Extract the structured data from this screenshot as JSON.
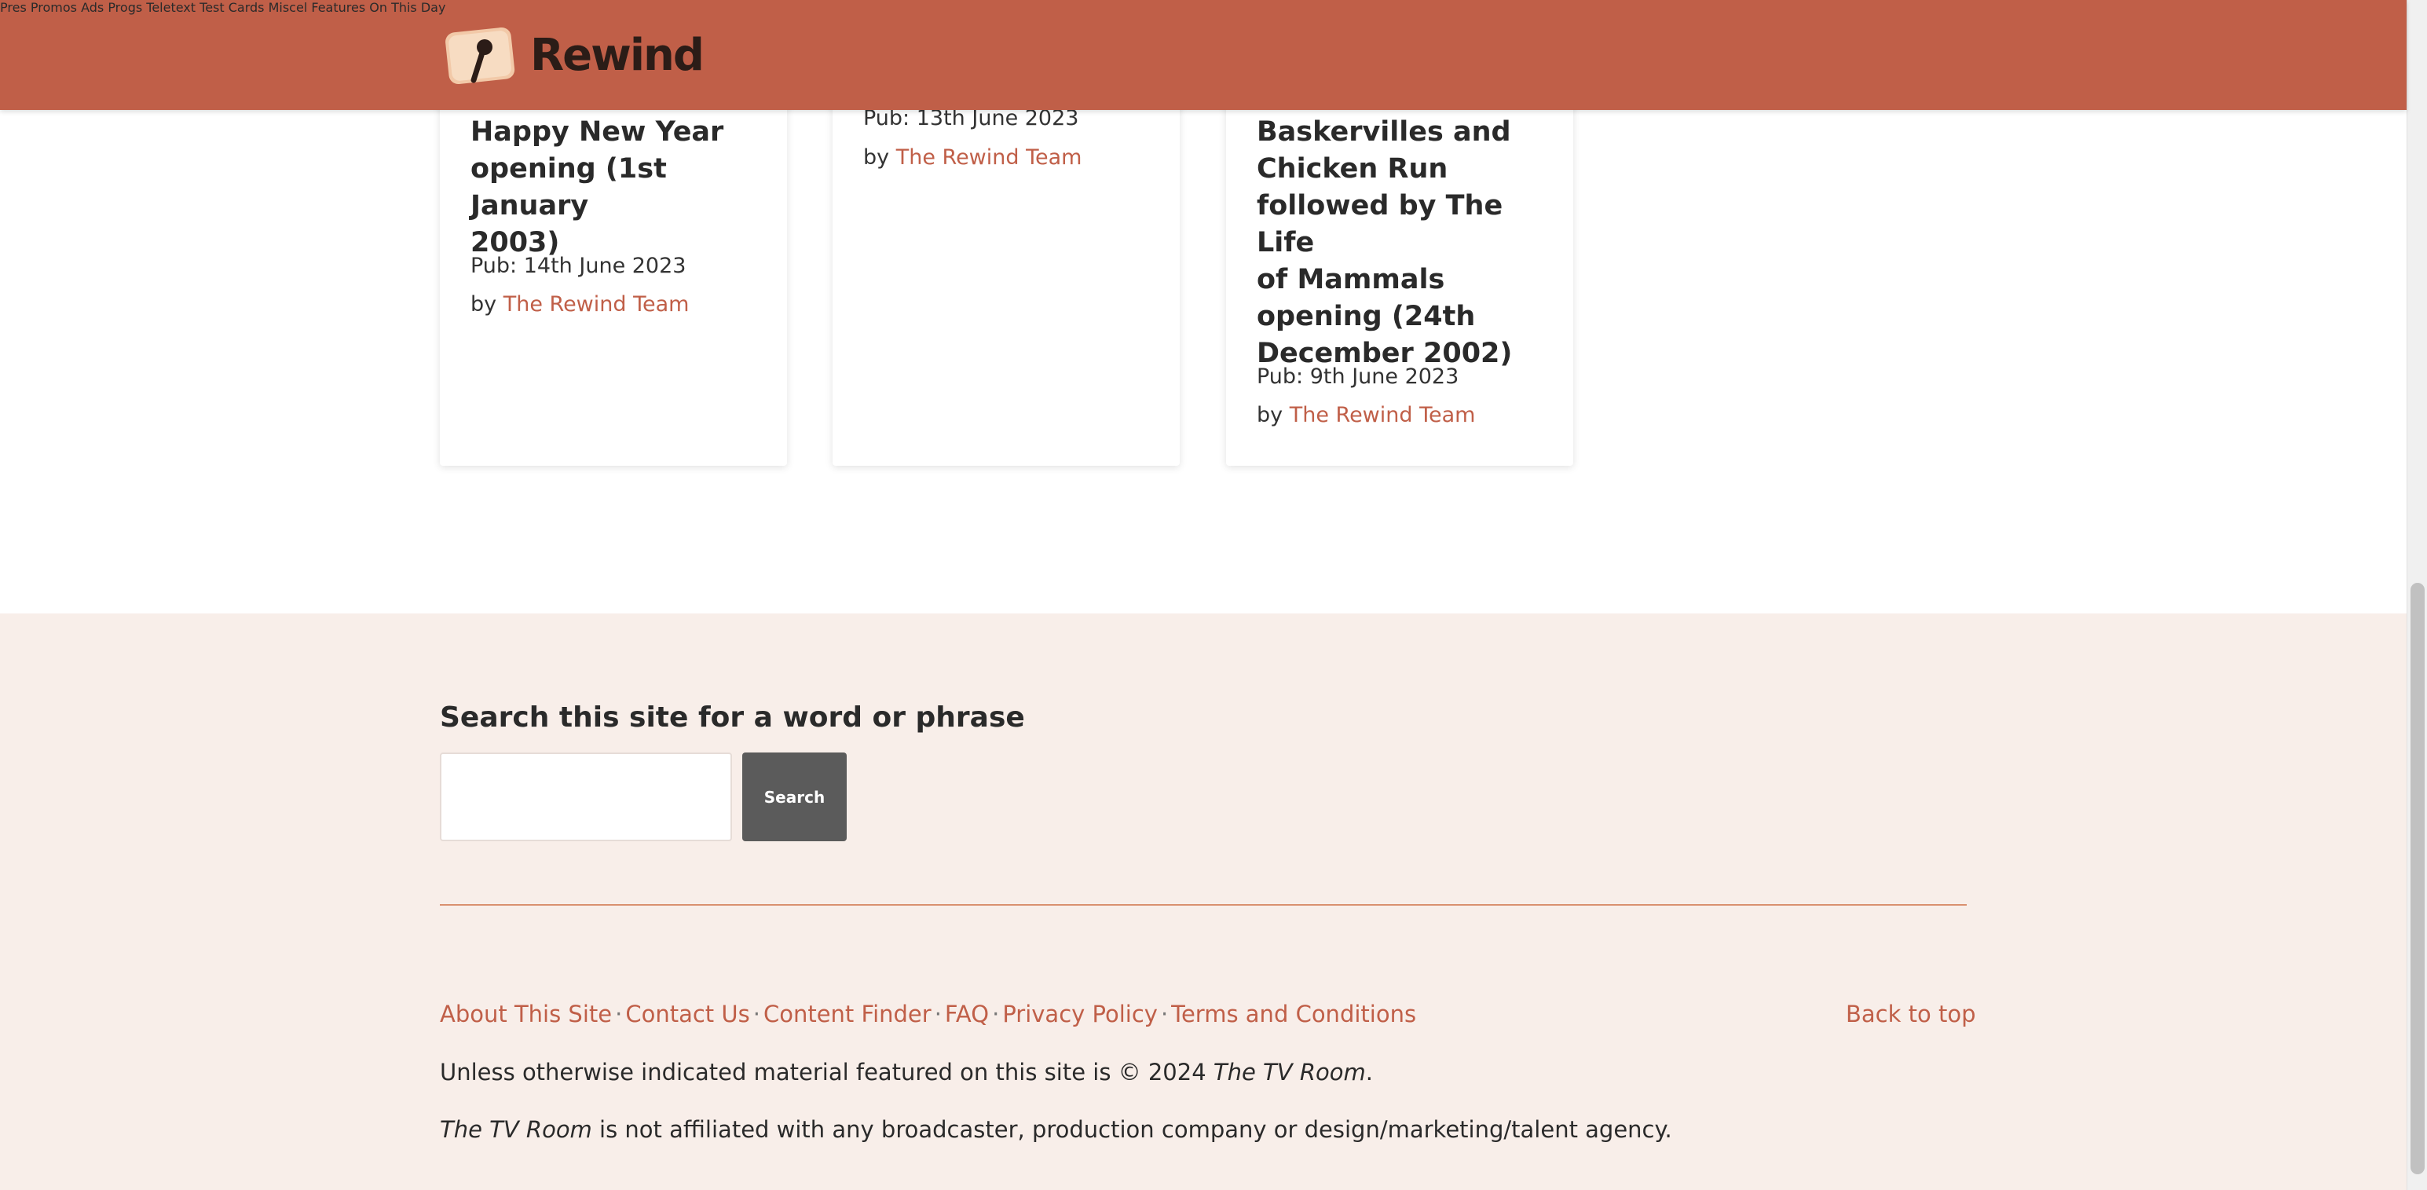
{
  "header": {
    "logo_text": "Rewind",
    "nav": [
      "Pres",
      "Promos",
      "Ads",
      "Progs",
      "Teletext",
      "Test Cards",
      "Miscel",
      "Features",
      "On This Day"
    ]
  },
  "cards": [
    {
      "title_lines": [
        "Happy New Year",
        "opening (1st January",
        "2003)"
      ],
      "pub": "Pub: 14th June 2023",
      "by": "by",
      "author": "The Rewind Team"
    },
    {
      "title_lines": [],
      "pub": "Pub: 13th June 2023",
      "by": "by",
      "author": "The Rewind Team"
    },
    {
      "title_lines": [
        "Baskervilles and",
        "Chicken Run",
        "followed by The Life",
        "of Mammals",
        "opening (24th",
        "December 2002)"
      ],
      "pub": "Pub: 9th June 2023",
      "by": "by",
      "author": "The Rewind Team"
    }
  ],
  "footer": {
    "search_heading": "Search this site for a word or phrase",
    "search_placeholder": "",
    "search_button": "Search",
    "links": [
      "About This Site",
      "Contact Us",
      "Content Finder",
      "FAQ",
      "Privacy Policy",
      "Terms and Conditions"
    ],
    "separator": "·",
    "back_to_top": "Back to top",
    "copyright_prefix": "Unless otherwise indicated material featured on this site is © 2024 ",
    "copyright_name": "The TV Room",
    "copyright_suffix": ".",
    "affiliation_name": "The TV Room",
    "affiliation_text": " is not affiliated with any broadcaster, production company or design/marketing/talent agency."
  },
  "colors": {
    "brand": "#c05f48",
    "footer_bg": "#f8eee9",
    "button_bg": "#5b5b5b"
  }
}
